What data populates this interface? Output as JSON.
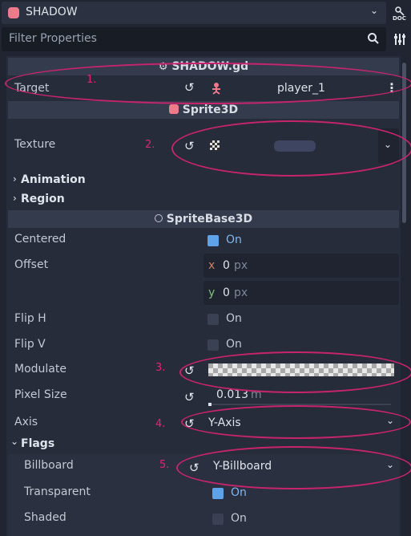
{
  "header": {
    "node_name": "SHADOW",
    "doc_label": "DOC"
  },
  "filter": {
    "placeholder": "Filter Properties"
  },
  "script_section": {
    "title": "SHADOW.gd"
  },
  "target": {
    "label": "Target",
    "value": "player_1"
  },
  "sprite3d_section": {
    "title": "Sprite3D"
  },
  "texture": {
    "label": "Texture"
  },
  "groups": {
    "animation": "Animation",
    "region": "Region",
    "flags": "Flags"
  },
  "spritebase_section": {
    "title": "SpriteBase3D"
  },
  "centered": {
    "label": "Centered",
    "value": "On",
    "checked": true
  },
  "offset": {
    "label": "Offset",
    "x_label": "x",
    "x": "0",
    "y_label": "y",
    "y": "0",
    "unit": "px"
  },
  "flip_h": {
    "label": "Flip H",
    "value": "On",
    "checked": false
  },
  "flip_v": {
    "label": "Flip V",
    "value": "On",
    "checked": false
  },
  "modulate": {
    "label": "Modulate"
  },
  "pixel_size": {
    "label": "Pixel Size",
    "value": "0.013",
    "unit": "m"
  },
  "axis": {
    "label": "Axis",
    "value": "Y-Axis"
  },
  "billboard": {
    "label": "Billboard",
    "value": "Y-Billboard"
  },
  "transparent": {
    "label": "Transparent",
    "value": "On",
    "checked": true
  },
  "shaded": {
    "label": "Shaded",
    "value": "On",
    "checked": false
  },
  "annotations": [
    "1.",
    "2.",
    "3.",
    "4.",
    "5."
  ],
  "colors": {
    "accent": "#5ea3e8",
    "annotation": "#c8246e",
    "panel": "#262c3a",
    "header": "#343b4c"
  }
}
